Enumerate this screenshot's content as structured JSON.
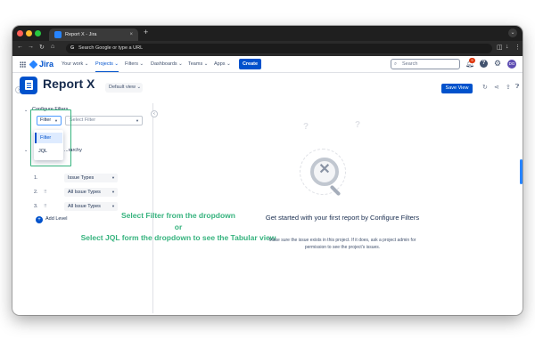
{
  "browser": {
    "tab_title": "Report X - Jira",
    "tab_close": "×",
    "new_tab": "+",
    "address": "Search Google or type a URL",
    "google_g": "G"
  },
  "nav": {
    "logo": "Jira",
    "items": [
      "Your work ⌄",
      "Projects ⌄",
      "Filters ⌄",
      "Dashboards ⌄",
      "Teams ⌄",
      "Apps ⌄"
    ],
    "create": "Create",
    "search_placeholder": "Search",
    "notifications_count": "9",
    "avatar_initials": "DG"
  },
  "report": {
    "title": "Report X",
    "view": "Default view ⌄",
    "save": "Save View"
  },
  "sidebar": {
    "configure_filters": "Configure Filters",
    "filter_select": "Filter",
    "filter_input_placeholder": "Select Filter",
    "dropdown_options": [
      "Filter",
      "JQL"
    ],
    "hierarchy_label": "...rarchy",
    "levels": [
      {
        "num": "1.",
        "value": "Issue Types"
      },
      {
        "num": "2.",
        "value": "All Issue Types"
      },
      {
        "num": "3.",
        "value": "All Issue Types"
      }
    ],
    "add_level": "Add Level"
  },
  "instructions": {
    "line1": "Select Filter from the dropdown",
    "line2": "or",
    "line3": "Select JQL form the dropdown to see the Tabular view"
  },
  "empty_state": {
    "title": "Get started with your first report by Configure Filters",
    "subtitle": "Make sure the issue exists in this project. If it does, ask a project admin for permission to see the project's issues."
  },
  "colors": {
    "accent": "#0052cc",
    "annotation": "#36b37e"
  }
}
